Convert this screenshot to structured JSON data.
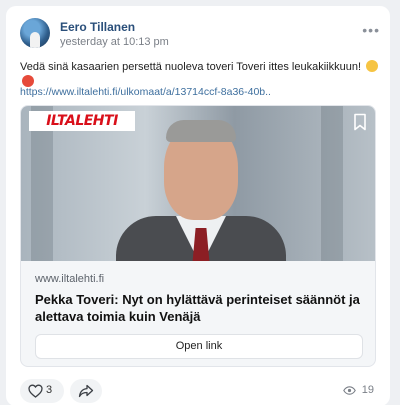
{
  "post": {
    "author": "Eero Tillanen",
    "timestamp": "yesterday at 10:13 pm",
    "more_icon": "more-horizontal-icon",
    "text": "Vedä sinä kasaarien persettä nuoleva toveri Toveri ittes leukakiikkuun!",
    "emojis": [
      "thumbs-up-emoji",
      "angry-face-emoji"
    ],
    "link": "https://www.iltalehti.fi/ulkomaat/a/13714ccf-8a36-40b.."
  },
  "preview": {
    "logo": "ILTALEHTI",
    "bookmark_icon": "bookmark-icon",
    "domain": "www.iltalehti.fi",
    "headline": "Pekka Toveri: Nyt on hylättävä perinteiset säännöt ja alettava toimia kuin Venäjä",
    "open_label": "Open link"
  },
  "footer": {
    "like_count": "3",
    "like_icon": "heart-icon",
    "share_icon": "share-icon",
    "views_icon": "eye-icon",
    "views": "19"
  },
  "colors": {
    "author": "#2a4f7a",
    "link": "#3e6f9e",
    "brand_red": "#d90f1a"
  }
}
